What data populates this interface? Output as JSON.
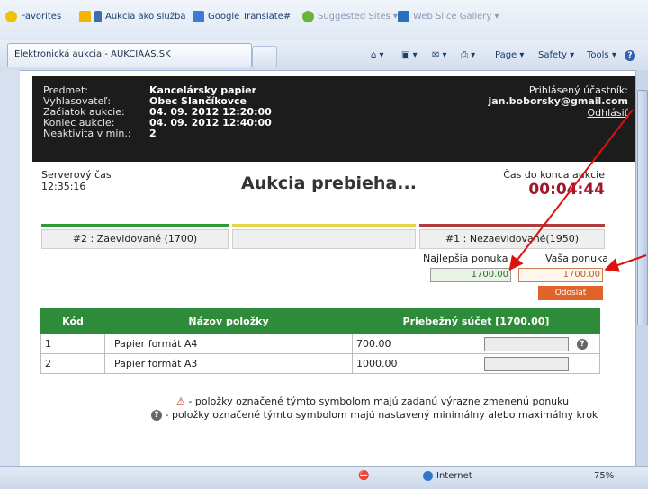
{
  "browser": {
    "favorites_label": "Favorites",
    "favorites": [
      {
        "label": "Aukcia ako služba"
      },
      {
        "label": "Google Translate#"
      },
      {
        "label": "Suggested Sites ▾"
      },
      {
        "label": "Web Slice Gallery ▾"
      }
    ],
    "tab_title": "Elektronická aukcia - AUKCIAAS.SK",
    "commands": {
      "page": "Page ▾",
      "safety": "Safety ▾",
      "tools": "Tools ▾",
      "help": "?"
    },
    "status": {
      "zone": "Internet",
      "zoom": "75%"
    },
    "colors": {
      "chrome": "#dfe8f4"
    }
  },
  "header": {
    "labels": [
      "Predmet:",
      "Vyhlasovateľ:",
      "Začiatok aukcie:",
      "Koniec aukcie:",
      "Neaktivita v min.:"
    ],
    "values": [
      "Kancelársky papier",
      "Obec Slančíkovce",
      "04. 09. 2012 12:20:00",
      "04. 09. 2012 12:40:00",
      "2"
    ],
    "participant_label": "Prihlásený účastník:",
    "participant_email": "jan.boborsky@gmail.com",
    "logout": "Odhlásiť"
  },
  "status": {
    "server_time_label": "Serverový čas",
    "server_time": "12:35:16",
    "title": "Aukcia prebieha...",
    "countdown_label": "Čas do konca aukcie",
    "countdown": "00:04:44"
  },
  "positions": {
    "left_tab": "#2 : Zaevidované (1700)",
    "middle_tab": "",
    "right_tab": "#1 : Nezaevidované(1950)",
    "colors": {
      "green": "#2e9a3a",
      "yellow": "#e4d64b",
      "red": "#b23b3b"
    }
  },
  "offer": {
    "best_label": "Najlepšia ponuka",
    "best_value": "1700.00",
    "your_label": "Vaša ponuka",
    "your_value": "1700.00",
    "send_button": "Odoslať",
    "button_color": "#e0632a"
  },
  "table": {
    "columns": [
      "Kód",
      "Názov položky",
      "Priebežný súčet [1700.00]"
    ],
    "rows": [
      {
        "code": "1",
        "name": "Papier formát A4",
        "value": "700.00"
      },
      {
        "code": "2",
        "name": "Papier formát A3",
        "value": "1000.00"
      }
    ]
  },
  "legend": {
    "warning": "- položky označené týmto symbolom majú zadanú výrazne zmenenú ponuku",
    "question": "- položky označené týmto symbolom majú nastavený minimálny alebo maximálny krok"
  }
}
